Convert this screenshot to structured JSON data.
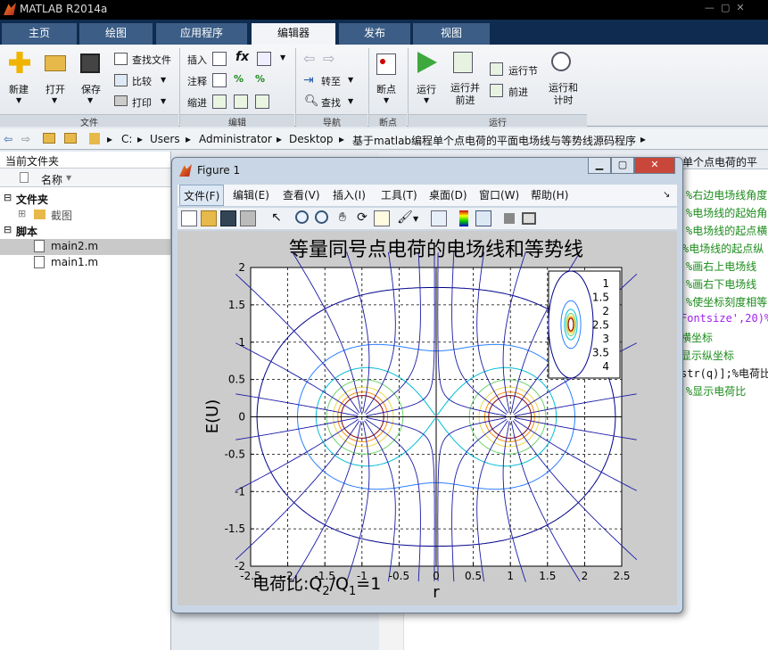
{
  "app": {
    "title": "MATLAB R2014a"
  },
  "tabs": [
    "主页",
    "绘图",
    "应用程序",
    "编辑器",
    "发布",
    "视图"
  ],
  "ribbon": {
    "new": "新建",
    "open": "打开",
    "save": "保存",
    "find_files": "查找文件",
    "compare": "比较",
    "print": "打印",
    "insert": "插入",
    "comment": "注释",
    "indent": "缩进",
    "goto": "转至",
    "find": "查找",
    "breakpoints": "断点",
    "run": "运行",
    "run_advance": "运行并\n前进",
    "run_section": "运行节",
    "advance": "前进",
    "run_time": "运行和\n计时",
    "groups": {
      "file": "文件",
      "edit": "编辑",
      "nav": "导航",
      "bp": "断点",
      "run": "运行"
    }
  },
  "address": {
    "parts": [
      "C:",
      "Users",
      "Administrator",
      "Desktop",
      "基于matlab编程单个点电荷的平面电场线与等势线源码程序"
    ]
  },
  "left_panel": {
    "title": "当前文件夹",
    "column": "名称",
    "folder_section": "文件夹",
    "folder_item": "截图",
    "script_section": "脚本",
    "files": [
      "main2.m",
      "main1.m"
    ]
  },
  "editor_bg": {
    "lines": [
      "%右边电场线角度",
      "%电场线的起始角",
      "%电场线的起点横",
      "%电场线的起点纵",
      "%画右上电场线",
      "%画右下电场线",
      "%使坐标刻度相等",
      "Fontsize',20)%",
      "横坐标",
      "显示纵坐标",
      "str(q)];%电荷比",
      "%显示电荷比"
    ],
    "header_fragment": "单个点电荷的平"
  },
  "figure": {
    "title": "Figure 1",
    "menu": [
      "文件(F)",
      "编辑(E)",
      "查看(V)",
      "插入(I)",
      "工具(T)",
      "桌面(D)",
      "窗口(W)",
      "帮助(H)"
    ]
  },
  "chart_data": {
    "type": "contour",
    "title": "等量同号点电荷的电场线和等势线",
    "xlabel": "r",
    "ylabel": "E(U)",
    "xlim": [
      -2.5,
      2.5
    ],
    "ylim": [
      -2,
      2
    ],
    "x_ticks": [
      "-2.5",
      "-2",
      "-1.5",
      "-1",
      "-0.5",
      "0",
      "0.5",
      "1",
      "1.5",
      "2",
      "2.5"
    ],
    "y_ticks": [
      "2",
      "1.5",
      "1",
      "0.5",
      "0",
      "-0.5",
      "-1",
      "-1.5",
      "-2"
    ],
    "grid": true,
    "charges": [
      {
        "x": -1,
        "y": 0
      },
      {
        "x": 1,
        "y": 0
      }
    ],
    "legend_position": "top-right",
    "levels": [
      {
        "value": 1,
        "label": "1",
        "color": "#00008b"
      },
      {
        "value": 1.5,
        "label": "1.5",
        "color": "#2a7fff"
      },
      {
        "value": 2,
        "label": "2",
        "color": "#00bcd4"
      },
      {
        "value": 2.5,
        "label": "2.5",
        "color": "#6bd36b"
      },
      {
        "value": 3,
        "label": "3",
        "color": "#e8d84b"
      },
      {
        "value": 3.5,
        "label": "3.5",
        "color": "#ff8c00"
      },
      {
        "value": 4,
        "label": "4",
        "color": "#8b0000"
      }
    ],
    "field_line_color": "#1a1aa6",
    "annotation": {
      "prefix": "电荷比:Q",
      "sub1": "2",
      "mid": "/Q",
      "sub2": "1",
      "suffix": "=1"
    }
  }
}
